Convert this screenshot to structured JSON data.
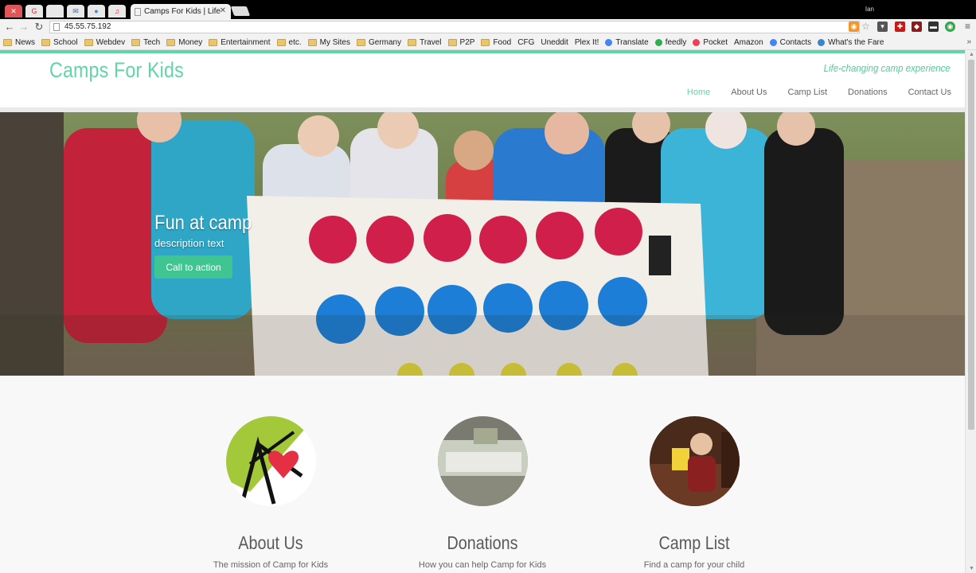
{
  "browser": {
    "tab_title": "Camps For Kids | Life",
    "url": "45.55.75.192",
    "user_name": "Ian",
    "bookmarks": [
      {
        "label": "News",
        "icon": "folder"
      },
      {
        "label": "School",
        "icon": "folder"
      },
      {
        "label": "Webdev",
        "icon": "folder"
      },
      {
        "label": "Tech",
        "icon": "folder"
      },
      {
        "label": "Money",
        "icon": "folder"
      },
      {
        "label": "Entertainment",
        "icon": "folder"
      },
      {
        "label": "etc.",
        "icon": "folder"
      },
      {
        "label": "My Sites",
        "icon": "folder"
      },
      {
        "label": "Germany",
        "icon": "folder"
      },
      {
        "label": "Travel",
        "icon": "folder"
      },
      {
        "label": "P2P",
        "icon": "folder"
      },
      {
        "label": "Food",
        "icon": "folder"
      },
      {
        "label": "CFG",
        "icon": "page"
      },
      {
        "label": "Uneddit",
        "icon": "page"
      },
      {
        "label": "Plex It!",
        "icon": "page"
      },
      {
        "label": "Translate",
        "icon": "translate"
      },
      {
        "label": "feedly",
        "icon": "feedly"
      },
      {
        "label": "Pocket",
        "icon": "pocket"
      },
      {
        "label": "Amazon",
        "icon": "page"
      },
      {
        "label": "Contacts",
        "icon": "google"
      },
      {
        "label": "What's the Fare",
        "icon": "fare"
      }
    ]
  },
  "site": {
    "title": "Camps For Kids",
    "tagline": "Life-changing camp experience",
    "nav": [
      "Home",
      "About Us",
      "Camp List",
      "Donations",
      "Contact Us"
    ],
    "hero": {
      "title": "Fun at camp",
      "description": "description text",
      "cta": "Call to action"
    },
    "features": [
      {
        "title": "About Us",
        "description": "The mission of Camp for Kids"
      },
      {
        "title": "Donations",
        "description": "How you can help Camp for Kids"
      },
      {
        "title": "Camp List",
        "description": "Find a camp for your child"
      }
    ]
  },
  "colors": {
    "accent": "#5fd6a8",
    "cta": "#3fc592",
    "nav_text": "#666666"
  }
}
